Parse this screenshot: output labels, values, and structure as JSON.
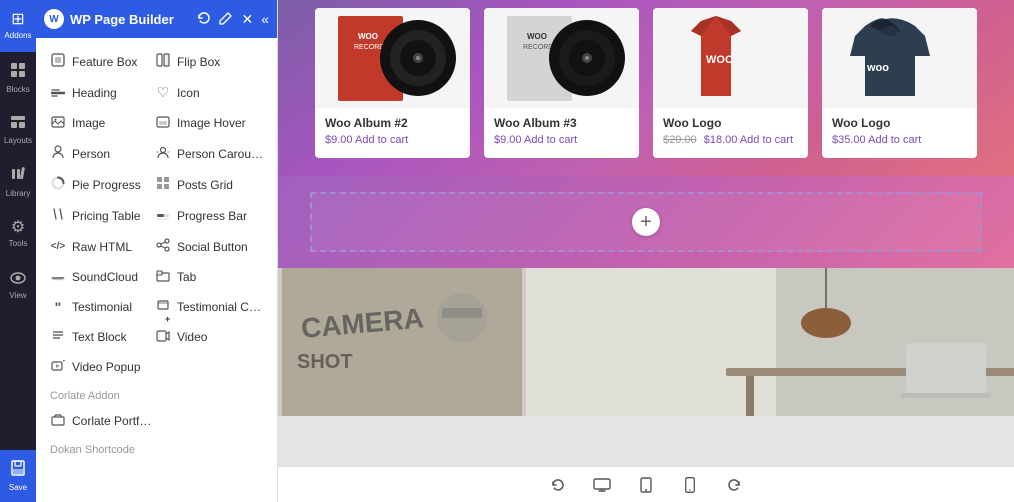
{
  "app": {
    "title": "WP Page Builder",
    "logo_text": "W"
  },
  "icon_bar": {
    "items": [
      {
        "id": "addons",
        "label": "Addons",
        "icon": "⊞",
        "active": true
      },
      {
        "id": "blocks",
        "label": "Blocks",
        "icon": "⬡"
      },
      {
        "id": "layouts",
        "label": "Layouts",
        "icon": "⊟"
      },
      {
        "id": "library",
        "label": "Library",
        "icon": "📚"
      },
      {
        "id": "tools",
        "label": "Tools",
        "icon": "⚙"
      },
      {
        "id": "view",
        "label": "View",
        "icon": "👁"
      },
      {
        "id": "save",
        "label": "Save",
        "icon": "💾"
      }
    ]
  },
  "panel": {
    "header_title": "WP Page Builder",
    "icons": [
      "refresh",
      "edit",
      "close",
      "collapse"
    ]
  },
  "widgets": {
    "columns": [
      [
        {
          "id": "feature-box",
          "label": "Feature Box",
          "icon": "◻"
        },
        {
          "id": "heading",
          "label": "Heading",
          "icon": "—"
        },
        {
          "id": "image",
          "label": "Image",
          "icon": "⬜"
        },
        {
          "id": "person",
          "label": "Person",
          "icon": "👤"
        },
        {
          "id": "pie-progress",
          "label": "Pie Progress",
          "icon": "◔"
        },
        {
          "id": "pricing-table",
          "label": "Pricing Table",
          "icon": "✏"
        },
        {
          "id": "raw-html",
          "label": "Raw HTML",
          "icon": "<>"
        },
        {
          "id": "soundcloud",
          "label": "SoundCloud",
          "icon": "🎵"
        },
        {
          "id": "testimonial",
          "label": "Testimonial",
          "icon": "❝"
        },
        {
          "id": "text-block",
          "label": "Text Block",
          "icon": "T"
        },
        {
          "id": "video-popup",
          "label": "Video Popup",
          "icon": "▶"
        }
      ],
      [
        {
          "id": "flip-box",
          "label": "Flip Box",
          "icon": "⬡"
        },
        {
          "id": "icon",
          "label": "Icon",
          "icon": "♡"
        },
        {
          "id": "image-hover",
          "label": "Image Hover",
          "icon": "⬜"
        },
        {
          "id": "person-carousel",
          "label": "Person Carou…",
          "icon": "👤"
        },
        {
          "id": "posts-grid",
          "label": "Posts Grid",
          "icon": "⊞"
        },
        {
          "id": "progress-bar",
          "label": "Progress Bar",
          "icon": "▬"
        },
        {
          "id": "social-button",
          "label": "Social Button",
          "icon": "👥"
        },
        {
          "id": "tab",
          "label": "Tab",
          "icon": "⬜"
        },
        {
          "id": "testimonial-carousel",
          "label": "Testimonial C…",
          "icon": "❝"
        },
        {
          "id": "video",
          "label": "Video",
          "icon": "▶"
        }
      ]
    ]
  },
  "sections": {
    "corlate_addon_label": "Corlate Addon",
    "corlate_portfolio_label": "Corlate Portf…",
    "dokan_shortcode_label": "Dokan Shortcode"
  },
  "products": [
    {
      "name": "Woo Album #2",
      "price": "$9.00",
      "has_add_to_cart": true,
      "type": "album2"
    },
    {
      "name": "Woo Album #3",
      "price": "$9.00",
      "has_add_to_cart": true,
      "type": "album3"
    },
    {
      "name": "Woo Logo",
      "old_price": "$20.00",
      "price": "$18.00",
      "has_add_to_cart": true,
      "type": "shirt"
    },
    {
      "name": "Woo Logo",
      "price": "$35.00",
      "has_add_to_cart": true,
      "type": "hoodie"
    }
  ],
  "toolbar": {
    "undo_label": "↺",
    "desktop_label": "🖥",
    "tablet_label": "⬜",
    "mobile_label": "📱",
    "redo_label": "↻"
  },
  "colors": {
    "panel_header": "#2d5be3",
    "gradient_start": "#7b5ea7",
    "gradient_end": "#e87090",
    "brand": "#2d5be3"
  }
}
